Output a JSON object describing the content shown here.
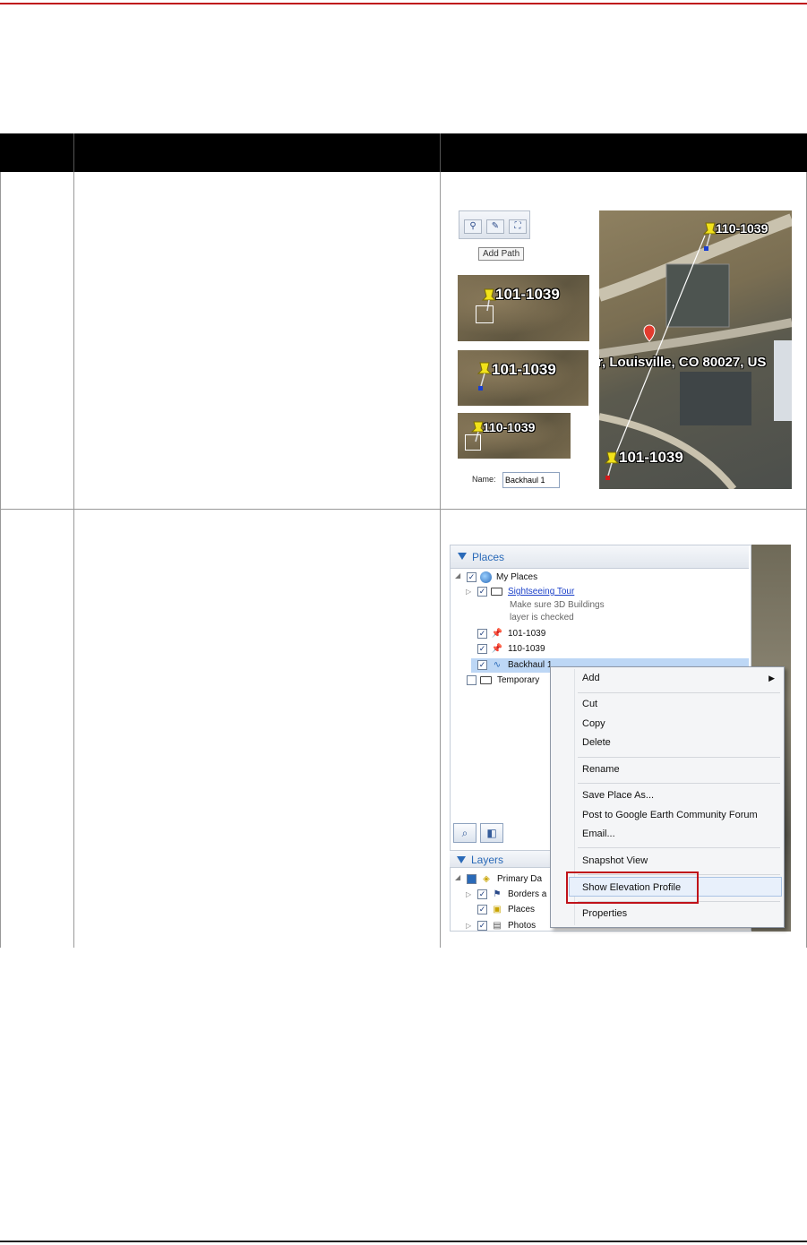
{
  "row1": {
    "toolbar_tooltip": "Add Path",
    "pin_a": "101-1039",
    "pin_b": "110-1039",
    "map_label_a": "110-1039",
    "map_label_b": "101-1039",
    "address": "r, Louisville, CO 80027, US",
    "name_label": "Name:",
    "name_value": "Backhaul 1"
  },
  "row2": {
    "panel_title": "Places",
    "tree": {
      "my_places": "My Places",
      "sightseeing": "Sightseeing Tour",
      "note_line1": "Make sure 3D Buildings",
      "note_line2": "layer is checked",
      "pin1": "101-1039",
      "pin2": "110-1039",
      "path": "Backhaul 1",
      "temporary": "Temporary"
    },
    "layers_title": "Layers",
    "layers": {
      "primary": "Primary Da",
      "borders": "Borders a",
      "places": "Places",
      "photos": "Photos"
    },
    "menu": {
      "add": "Add",
      "cut": "Cut",
      "copy": "Copy",
      "delete": "Delete",
      "rename": "Rename",
      "save_place_as": "Save Place As...",
      "post_forum": "Post to Google Earth Community Forum",
      "email": "Email...",
      "snapshot": "Snapshot View",
      "elevation": "Show Elevation Profile",
      "properties": "Properties"
    }
  },
  "colors": {
    "accent_red": "#c0121a",
    "header_black": "#000000",
    "link_blue": "#1a3fc8",
    "selection": "#bdd7f5"
  }
}
